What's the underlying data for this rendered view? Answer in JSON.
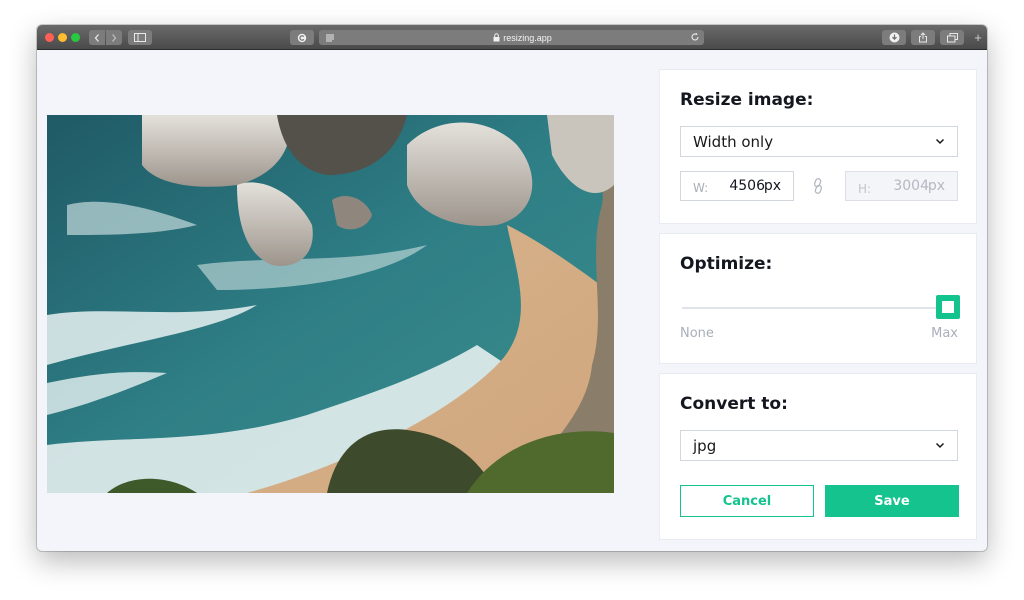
{
  "browser": {
    "url": "resizing.app",
    "traffic_lights": [
      "#ff5f57",
      "#febc2e",
      "#28c840"
    ]
  },
  "resize": {
    "title": "Resize image:",
    "mode": "Width only",
    "width_label": "W:",
    "width_value": "4506",
    "height_label": "H:",
    "height_value": "3004",
    "unit": "px"
  },
  "optimize": {
    "title": "Optimize:",
    "min_label": "None",
    "max_label": "Max",
    "level_fraction": 1.0
  },
  "convert": {
    "title": "Convert to:",
    "format": "jpg"
  },
  "actions": {
    "cancel_label": "Cancel",
    "save_label": "Save"
  },
  "colors": {
    "accent": "#14c38e",
    "background": "#f3f5fa"
  }
}
